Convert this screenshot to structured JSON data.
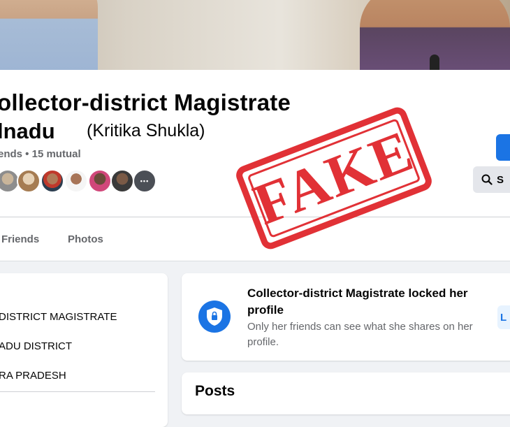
{
  "profile": {
    "name_line1": "ollector-district Magistrate",
    "name_line2": "lnadu",
    "alternate_name": "(Kritika Shukla)",
    "friends_summary": "ends • 15 mutual",
    "more_friends_glyph": "•••",
    "stamp_text": "FAKE"
  },
  "actions": {
    "search_label": "S"
  },
  "tabs": [
    {
      "label": "Friends"
    },
    {
      "label": "Photos"
    }
  ],
  "intro": {
    "items": [
      "DISTRICT MAGISTRATE",
      "ADU DISTRICT",
      "RA PRADESH"
    ]
  },
  "locked": {
    "title": "Collector-district Magistrate locked her profile",
    "description": "Only her friends can see what she shares on her profile.",
    "button_label": "L"
  },
  "posts": {
    "title": "Posts"
  },
  "colors": {
    "accent": "#1b74e4",
    "stamp": "#e0262c",
    "muted_text": "#65676b"
  }
}
